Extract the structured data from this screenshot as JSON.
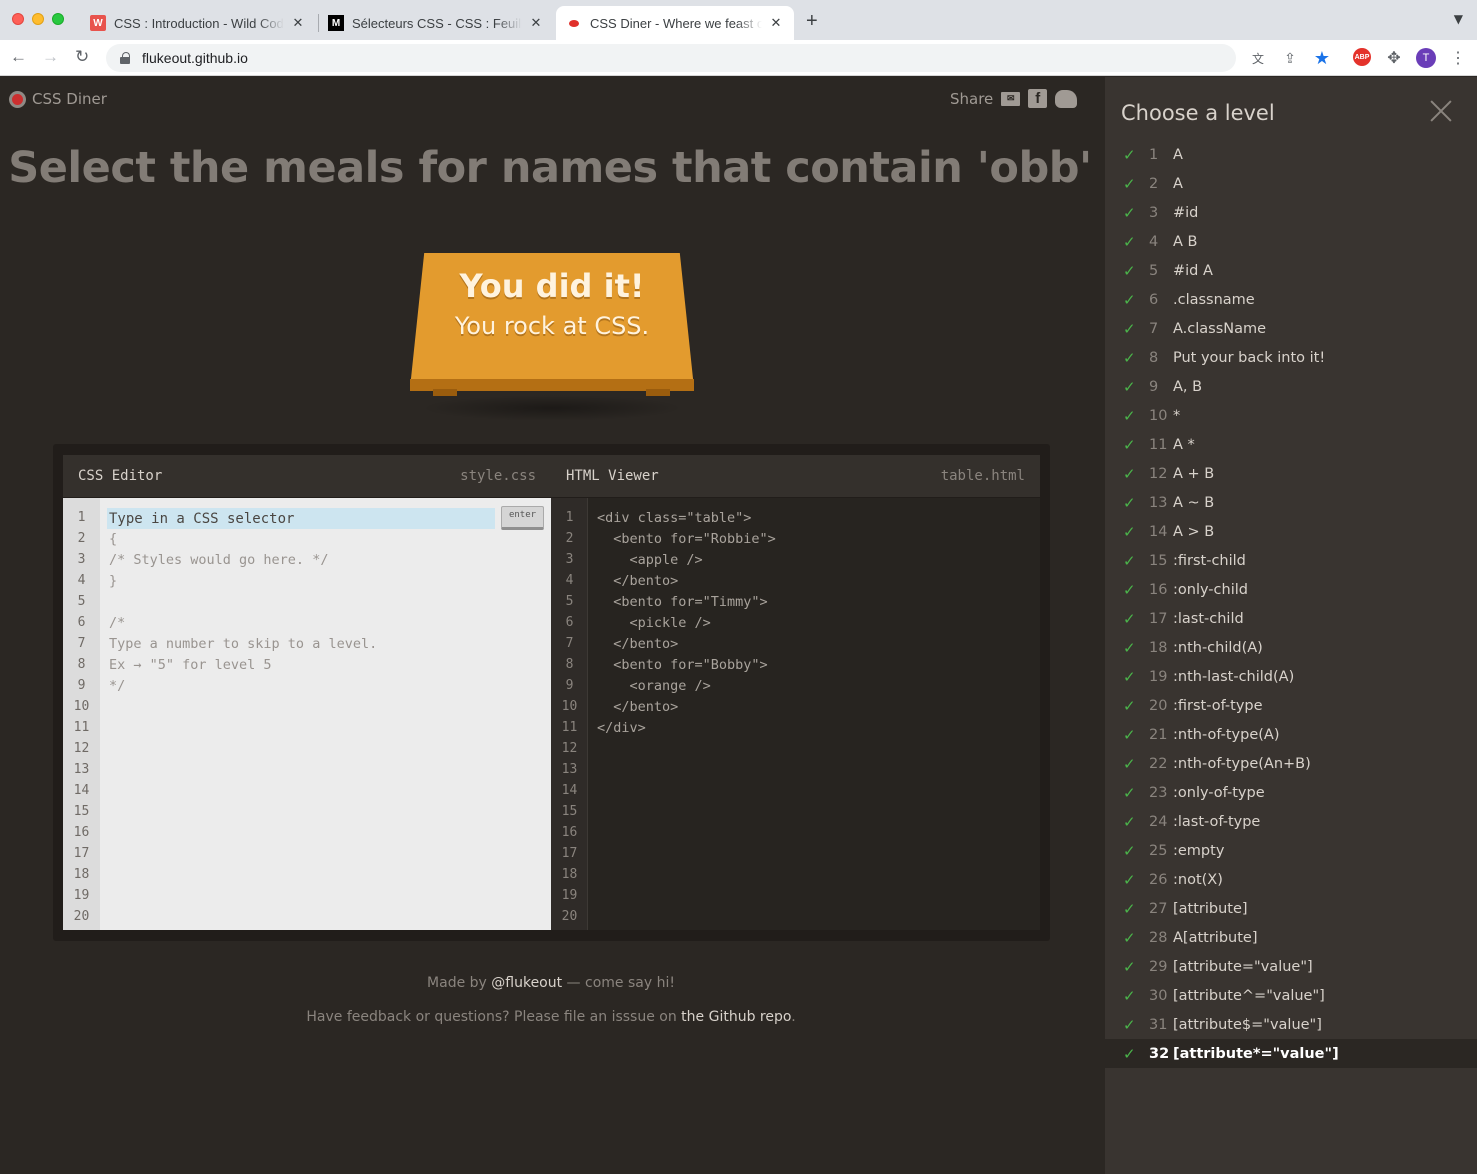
{
  "browser": {
    "tabs": [
      {
        "title": "CSS : Introduction - Wild Code School",
        "icon": "wild-code-school-icon"
      },
      {
        "title": "Sélecteurs CSS - CSS : Feuilles de style",
        "icon": "mdn-icon"
      },
      {
        "title": "CSS Diner - Where we feast on CSS selectors",
        "icon": "css-diner-icon"
      }
    ],
    "url": "flukeout.github.io",
    "profile_initial": "T",
    "abp_label": "ABP"
  },
  "header": {
    "logo_text": "CSS Diner",
    "share_label": "Share"
  },
  "order": "Select the meals for names that contain 'obb'",
  "success": {
    "line1": "You did it!",
    "line2": "You rock at CSS."
  },
  "css_editor": {
    "title": "CSS Editor",
    "filename": "style.css",
    "input_placeholder": "Type in a CSS selector",
    "enter_label": "enter",
    "lines": [
      "{",
      "/* Styles would go here. */",
      "}",
      "",
      "/*",
      "Type a number to skip to a level.",
      "Ex → \"5\" for level 5",
      "*/"
    ],
    "line_numbers": [
      "1",
      "2",
      "3",
      "4",
      "5",
      "6",
      "7",
      "8",
      "9",
      "10",
      "11",
      "12",
      "13",
      "14",
      "15",
      "16",
      "17",
      "18",
      "19",
      "20"
    ]
  },
  "html_viewer": {
    "title": "HTML Viewer",
    "filename": "table.html",
    "lines": [
      "<div class=\"table\">",
      "  <bento for=\"Robbie\">",
      "    <apple />",
      "  </bento>",
      "  <bento for=\"Timmy\">",
      "    <pickle />",
      "  </bento>",
      "  <bento for=\"Bobby\">",
      "    <orange />",
      "  </bento>",
      "</div>"
    ],
    "line_numbers": [
      "1",
      "2",
      "3",
      "4",
      "5",
      "6",
      "7",
      "8",
      "9",
      "10",
      "11",
      "12",
      "13",
      "14",
      "15",
      "16",
      "17",
      "18",
      "19",
      "20"
    ]
  },
  "footer": {
    "made_by_prefix": "Made by ",
    "made_by_link": "@flukeout",
    "made_by_suffix": " — come say hi!",
    "feedback_prefix": "Have feedback or questions? Please file an isssue on ",
    "feedback_link": "the Github repo",
    "feedback_suffix": "."
  },
  "levels_panel": {
    "title": "Choose a level",
    "current_level": "32",
    "levels": [
      {
        "num": "1",
        "name": "A"
      },
      {
        "num": "2",
        "name": "A"
      },
      {
        "num": "3",
        "name": "#id"
      },
      {
        "num": "4",
        "name": "A  B"
      },
      {
        "num": "5",
        "name": "#id  A"
      },
      {
        "num": "6",
        "name": ".classname"
      },
      {
        "num": "7",
        "name": "A.className"
      },
      {
        "num": "8",
        "name": "Put your back into it!"
      },
      {
        "num": "9",
        "name": "A, B"
      },
      {
        "num": "10",
        "name": "*"
      },
      {
        "num": "11",
        "name": "A  *"
      },
      {
        "num": "12",
        "name": "A + B"
      },
      {
        "num": "13",
        "name": "A ~ B"
      },
      {
        "num": "14",
        "name": "A > B"
      },
      {
        "num": "15",
        "name": ":first-child"
      },
      {
        "num": "16",
        "name": ":only-child"
      },
      {
        "num": "17",
        "name": ":last-child"
      },
      {
        "num": "18",
        "name": ":nth-child(A)"
      },
      {
        "num": "19",
        "name": ":nth-last-child(A)"
      },
      {
        "num": "20",
        "name": ":first-of-type"
      },
      {
        "num": "21",
        "name": ":nth-of-type(A)"
      },
      {
        "num": "22",
        "name": ":nth-of-type(An+B)"
      },
      {
        "num": "23",
        "name": ":only-of-type"
      },
      {
        "num": "24",
        "name": ":last-of-type"
      },
      {
        "num": "25",
        "name": ":empty"
      },
      {
        "num": "26",
        "name": ":not(X)"
      },
      {
        "num": "27",
        "name": "[attribute]"
      },
      {
        "num": "28",
        "name": "A[attribute]"
      },
      {
        "num": "29",
        "name": "[attribute=\"value\"]"
      },
      {
        "num": "30",
        "name": "[attribute^=\"value\"]"
      },
      {
        "num": "31",
        "name": "[attribute$=\"value\"]"
      },
      {
        "num": "32",
        "name": "[attribute*=\"value\"]"
      }
    ]
  }
}
